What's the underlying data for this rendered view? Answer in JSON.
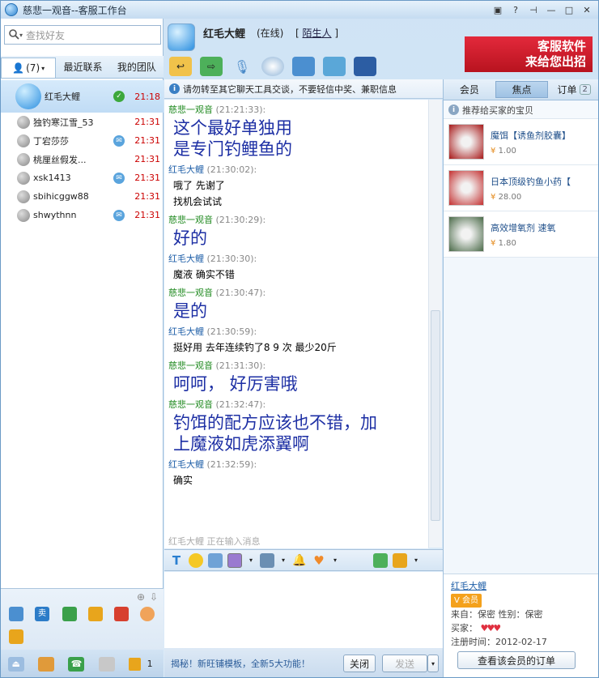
{
  "window": {
    "title": "慈悲一观音--客服工作台"
  },
  "left": {
    "search_placeholder": "查找好友",
    "tabs": [
      {
        "label": "(7)"
      },
      {
        "label": "最近联系"
      },
      {
        "label": "我的团队"
      }
    ],
    "contacts": [
      {
        "name": "红毛大鲤",
        "time": "21:18",
        "status": "ok"
      },
      {
        "name": "独钓寒江雪_53",
        "time": "21:31",
        "status": ""
      },
      {
        "name": "丁宕莎莎",
        "time": "21:31",
        "status": "msg"
      },
      {
        "name": "桃厘丝假发...",
        "time": "21:31",
        "status": ""
      },
      {
        "name": "xsk1413",
        "time": "21:31",
        "status": "msg"
      },
      {
        "name": "sbihicggw88",
        "time": "21:31",
        "status": ""
      },
      {
        "name": "shwythnn",
        "time": "21:31",
        "status": "msg"
      }
    ],
    "bottom_count": "1"
  },
  "header": {
    "name": "红毛大鲤",
    "status": "(在线)",
    "relation_open": "[",
    "relation": "陌生人",
    "relation_close": "]"
  },
  "ad": {
    "line1": "客服软件",
    "line2": "来给您出招"
  },
  "notice": "请勿转至其它聊天工具交谈，不要轻信中奖、兼职信息",
  "messages": [
    {
      "sender": "慈悲一观音",
      "time": "(21:21:33):",
      "role": "me",
      "size": "big",
      "lines": [
        "这个最好单独用",
        "是专门钓鲤鱼的"
      ]
    },
    {
      "sender": "红毛大鲤",
      "time": "(21:30:02):",
      "role": "them",
      "size": "small",
      "lines": [
        "哦了  先谢了",
        "找机会试试"
      ]
    },
    {
      "sender": "慈悲一观音",
      "time": "(21:30:29):",
      "role": "me",
      "size": "big",
      "lines": [
        "好的"
      ]
    },
    {
      "sender": "红毛大鲤",
      "time": "(21:30:30):",
      "role": "them",
      "size": "small",
      "lines": [
        "魔液 确实不错"
      ]
    },
    {
      "sender": "慈悲一观音",
      "time": "(21:30:47):",
      "role": "me",
      "size": "big",
      "lines": [
        "是的"
      ]
    },
    {
      "sender": "红毛大鲤",
      "time": "(21:30:59):",
      "role": "them",
      "size": "small",
      "lines": [
        "挺好用    去年连续钓了8 9 次   最少20斤"
      ]
    },
    {
      "sender": "慈悲一观音",
      "time": "(21:31:30):",
      "role": "me",
      "size": "big",
      "lines": [
        "呵呵，  好厉害哦"
      ]
    },
    {
      "sender": "慈悲一观音",
      "time": "(21:32:47):",
      "role": "me",
      "size": "big",
      "lines": [
        "钓饵的配方应该也不错，加",
        "上魔液如虎添翼啊"
      ]
    },
    {
      "sender": "红毛大鲤",
      "time": "(21:32:59):",
      "role": "them",
      "size": "small",
      "lines": [
        "确实"
      ]
    }
  ],
  "typing": "红毛大鲤 正在输入消息",
  "bottom": {
    "promo": "揭秘！新旺铺模板，全新5大功能！",
    "close": "关闭",
    "send": "发送"
  },
  "right": {
    "tabs": [
      {
        "label": "会员"
      },
      {
        "label": "焦点"
      },
      {
        "label": "订单"
      }
    ],
    "order_count": "2",
    "recommend": "推荐给买家的宝贝",
    "products": [
      {
        "name": "魔饵【诱鱼剂胶囊】",
        "price": "1.00",
        "color": "#a81818"
      },
      {
        "name": "日本顶级钓鱼小药【",
        "price": "28.00",
        "color": "#c43030"
      },
      {
        "name": "高效增氧剂 速氧",
        "price": "1.80",
        "color": "#4a6a48"
      }
    ],
    "member": {
      "name": "红毛大鲤",
      "vip": "会员",
      "from_label": "来自：",
      "from": "保密",
      "gender_label": "性别：",
      "gender": "保密",
      "buyer_label": "买家：",
      "reg_label": "注册时间：",
      "reg": "2012-02-17",
      "orders_btn": "查看该会员的订单"
    }
  },
  "colors": {
    "accent": "#2b8fe0",
    "me": "#228b22",
    "them": "#1f5fa8",
    "big_text": "#1d2fa4",
    "time": "#cc0000"
  }
}
